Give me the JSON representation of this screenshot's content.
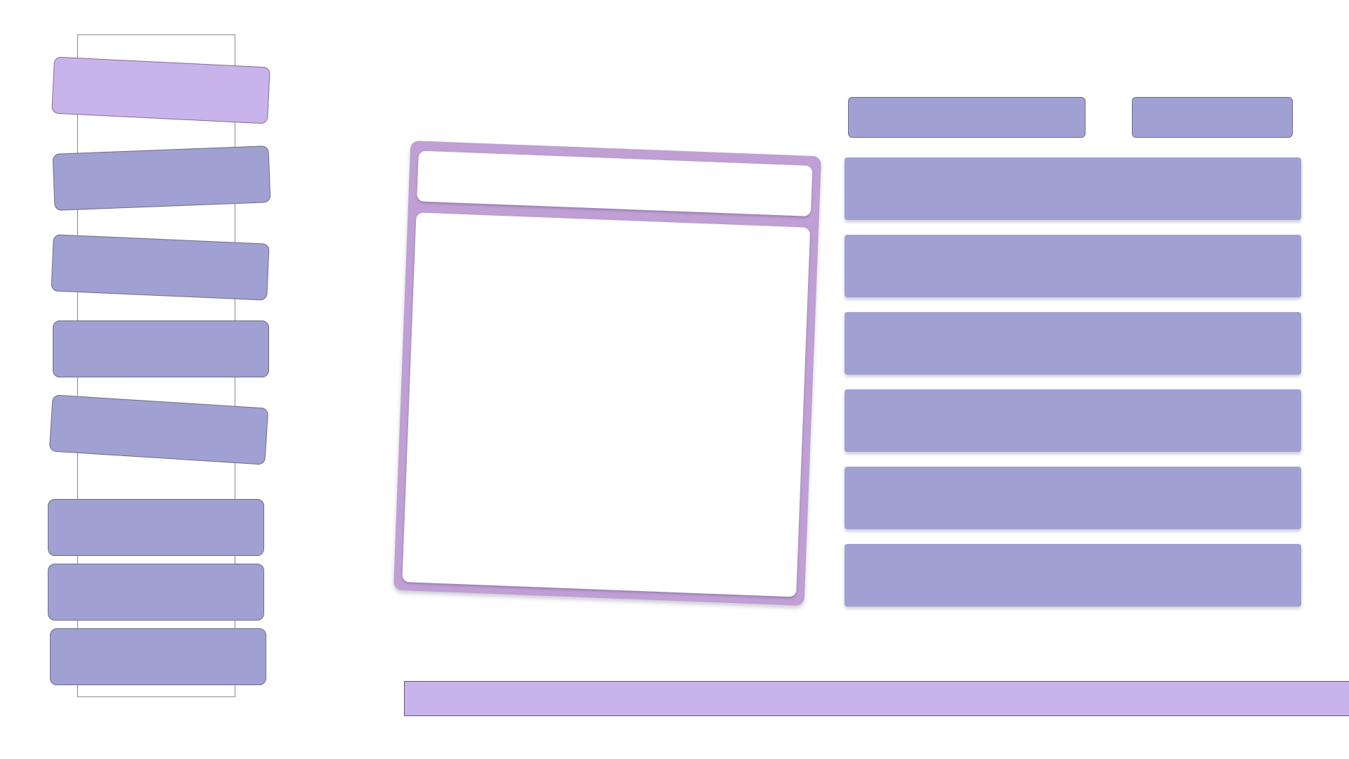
{
  "colors": {
    "tile": "#a0a0d2",
    "tile_active": "#c8b4ea",
    "panel": "#bf9fd4",
    "bottom_bar": "#c8b4ea",
    "rail_border": "#8a8a8a"
  },
  "rail": {
    "active_index": 0,
    "items": [
      "",
      "",
      "",
      "",
      "",
      "",
      "",
      ""
    ]
  },
  "panel": {
    "header_text": "",
    "body_text": ""
  },
  "toolbar": {
    "button_1": "",
    "button_2": ""
  },
  "list": {
    "rows": [
      "",
      "",
      "",
      "",
      "",
      ""
    ]
  },
  "bottom_bar": {
    "text": ""
  }
}
